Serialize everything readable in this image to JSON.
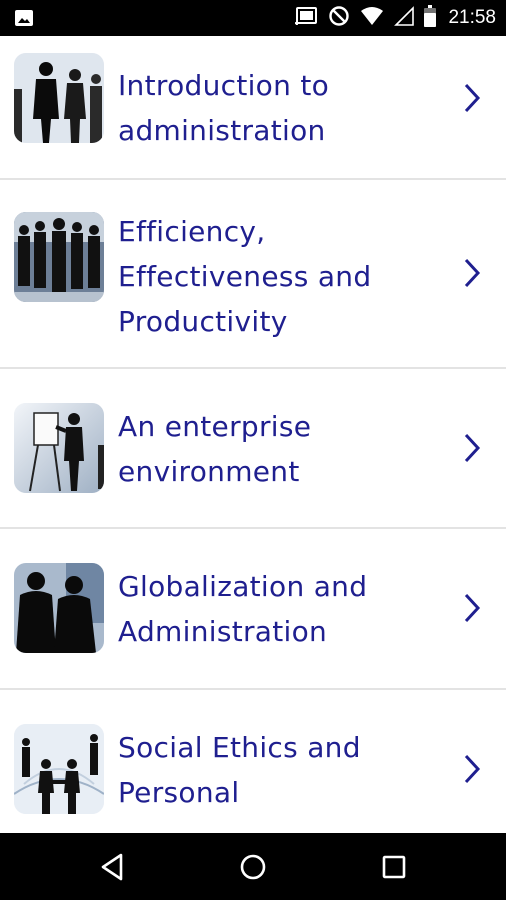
{
  "status_bar": {
    "time": "21:58",
    "icons": [
      "image-notification-icon",
      "cast-icon",
      "do-not-disturb-icon",
      "wifi-icon",
      "cell-signal-icon",
      "battery-icon"
    ]
  },
  "topics": [
    {
      "label": "Introduction to administration",
      "thumb": "business-people-icon"
    },
    {
      "label": "Efficiency, Effectiveness and Productivity",
      "thumb": "crowd-walking-icon"
    },
    {
      "label": "An enterprise environment",
      "thumb": "presentation-icon"
    },
    {
      "label": "Globalization and Administration",
      "thumb": "silhouettes-icon"
    },
    {
      "label": "Social Ethics and Personal",
      "thumb": "handshake-icon"
    }
  ],
  "nav": {
    "icons": [
      "back-icon",
      "home-icon",
      "recents-icon"
    ]
  },
  "colors": {
    "label": "#1f1f8f",
    "chevron": "#1f1f8f",
    "divider": "#e3e3e3"
  }
}
